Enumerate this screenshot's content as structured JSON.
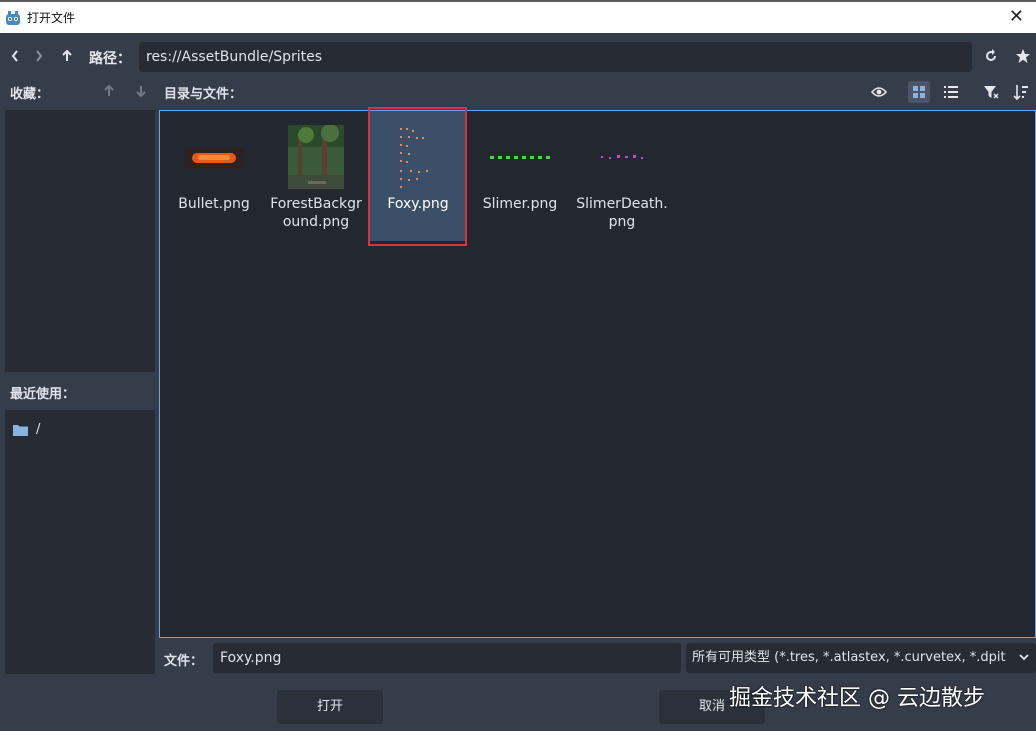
{
  "window": {
    "title": "打开文件",
    "close_glyph": "✕"
  },
  "toolbar": {
    "path_label": "路径：",
    "path_value": "res://AssetBundle/Sprites"
  },
  "favorites": {
    "label": "收藏："
  },
  "recent": {
    "label": "最近使用：",
    "items": [
      {
        "label": "/"
      }
    ]
  },
  "directory": {
    "label": "目录与文件："
  },
  "files": [
    {
      "name": "Bullet.png",
      "selected": false
    },
    {
      "name": "ForestBackground.png",
      "selected": false
    },
    {
      "name": "Foxy.png",
      "selected": true
    },
    {
      "name": "Slimer.png",
      "selected": false
    },
    {
      "name": "SlimerDeath.png",
      "selected": false
    }
  ],
  "footer": {
    "file_label": "文件：",
    "file_value": "Foxy.png",
    "filter_value": "所有可用类型 (*.tres, *.atlastex, *.curvetex, *.dpit",
    "open_label": "打开",
    "cancel_label": "取消"
  },
  "watermark": "掘金技术社区 @ 云边散步",
  "colors": {
    "background": "#363d4a",
    "panel": "#232830",
    "accent": "#6aa7e8",
    "selection": "#3b5068",
    "highlight": "#e0313a"
  }
}
